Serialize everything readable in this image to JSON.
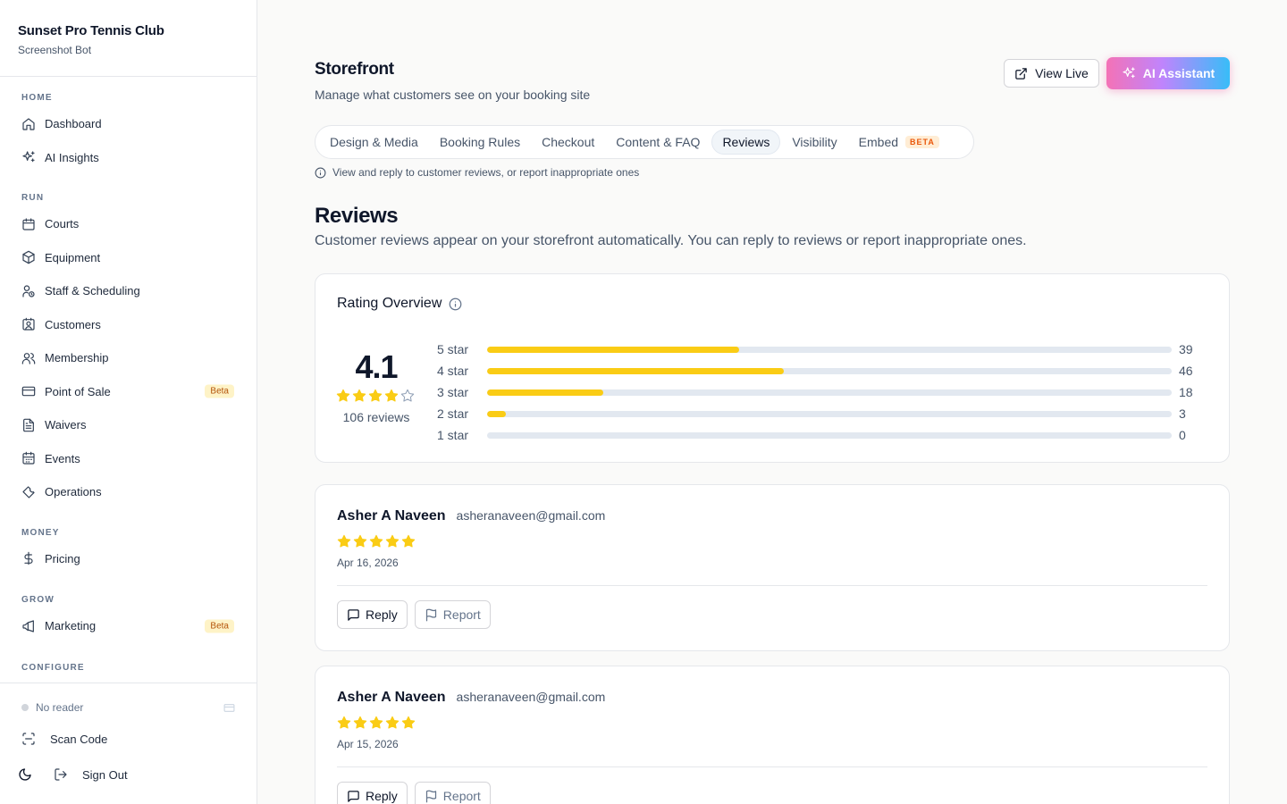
{
  "sidebar": {
    "brand": {
      "name": "Sunset Pro Tennis Club",
      "subtitle": "Screenshot Bot"
    },
    "sections": {
      "home": "HOME",
      "run": "RUN",
      "money": "MONEY",
      "grow": "GROW",
      "configure": "CONFIGURE"
    },
    "items": {
      "dashboard": "Dashboard",
      "ai_insights": "AI Insights",
      "courts": "Courts",
      "equipment": "Equipment",
      "staff": "Staff & Scheduling",
      "customers": "Customers",
      "membership": "Membership",
      "pos": "Point of Sale",
      "waivers": "Waivers",
      "events": "Events",
      "operations": "Operations",
      "pricing": "Pricing",
      "marketing": "Marketing"
    },
    "beta_label": "Beta",
    "footer": {
      "reader_status": "No reader",
      "scan_code": "Scan Code",
      "sign_out": "Sign Out"
    }
  },
  "header": {
    "title": "Storefront",
    "subtitle": "Manage what customers see on your booking site",
    "view_live": "View Live",
    "ai_assistant": "AI Assistant"
  },
  "tabs": {
    "design": "Design & Media",
    "booking_rules": "Booking Rules",
    "checkout": "Checkout",
    "content_faq": "Content & FAQ",
    "reviews": "Reviews",
    "visibility": "Visibility",
    "embed": "Embed",
    "embed_badge": "BETA",
    "active": "reviews",
    "hint": "View and reply to customer reviews, or report inappropriate ones"
  },
  "reviews_section": {
    "title": "Reviews",
    "description": "Customer reviews appear on your storefront automatically. You can reply to reviews or report inappropriate ones."
  },
  "overview": {
    "title": "Rating Overview",
    "average": "4.1",
    "average_stars": 4,
    "count_label": "106 reviews",
    "distribution": [
      {
        "label": "5 star",
        "count": 39,
        "fraction": 0.368
      },
      {
        "label": "4 star",
        "count": 46,
        "fraction": 0.434
      },
      {
        "label": "3 star",
        "count": 18,
        "fraction": 0.17
      },
      {
        "label": "2 star",
        "count": 3,
        "fraction": 0.028
      },
      {
        "label": "1 star",
        "count": 0,
        "fraction": 0
      }
    ]
  },
  "reviews": [
    {
      "name": "Asher A Naveen",
      "email": "asheranaveen@gmail.com",
      "rating": 5,
      "date": "Apr 16, 2026"
    },
    {
      "name": "Asher A Naveen",
      "email": "asheranaveen@gmail.com",
      "rating": 5,
      "date": "Apr 15, 2026"
    }
  ],
  "review_actions": {
    "reply": "Reply",
    "report": "Report"
  },
  "colors": {
    "star": "#facc15",
    "accent_gradient_start": "#f472b6",
    "accent_gradient_end": "#38bdf8"
  }
}
